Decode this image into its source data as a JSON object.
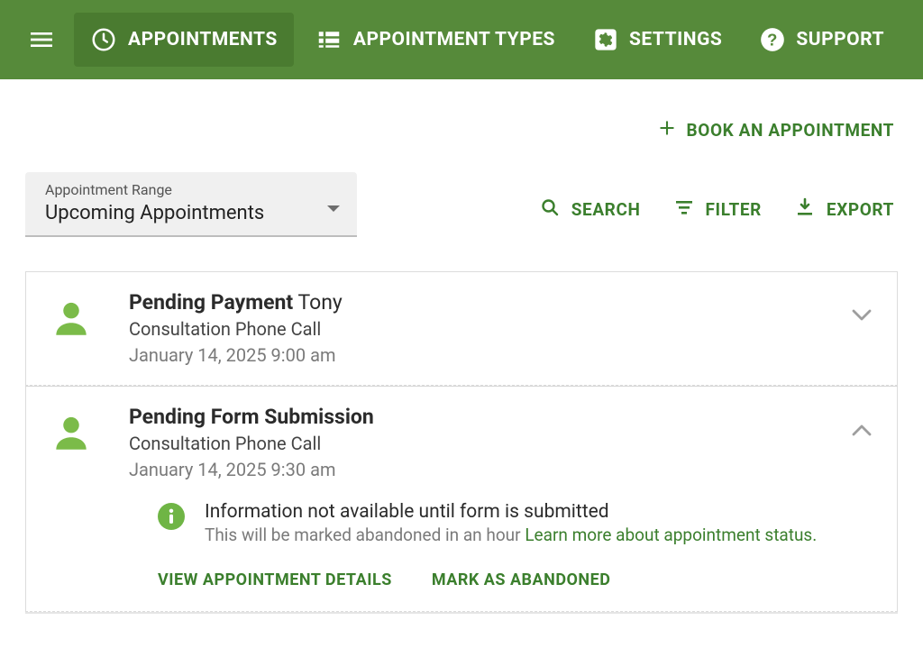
{
  "nav": {
    "items": [
      {
        "label": "APPOINTMENTS"
      },
      {
        "label": "APPOINTMENT TYPES"
      },
      {
        "label": "SETTINGS"
      },
      {
        "label": "SUPPORT"
      }
    ]
  },
  "book": {
    "label": "BOOK AN APPOINTMENT"
  },
  "range": {
    "label": "Appointment Range",
    "value": "Upcoming Appointments"
  },
  "toolbar": {
    "search": "SEARCH",
    "filter": "FILTER",
    "export": "EXPORT"
  },
  "appointments": [
    {
      "status": "Pending Payment",
      "name": "Tony",
      "type": "Consultation Phone Call",
      "datetime": "January 14, 2025 9:00 am",
      "expanded": false
    },
    {
      "status": "Pending Form Submission",
      "name": "",
      "type": "Consultation Phone Call",
      "datetime": "January 14, 2025 9:30 am",
      "expanded": true,
      "info": {
        "title": "Information not available until form is submitted",
        "sub_prefix": "This will be marked abandoned in an hour ",
        "link": "Learn more about appointment status."
      },
      "actions": {
        "view": "VIEW APPOINTMENT DETAILS",
        "abandon": "MARK AS ABANDONED"
      }
    }
  ]
}
